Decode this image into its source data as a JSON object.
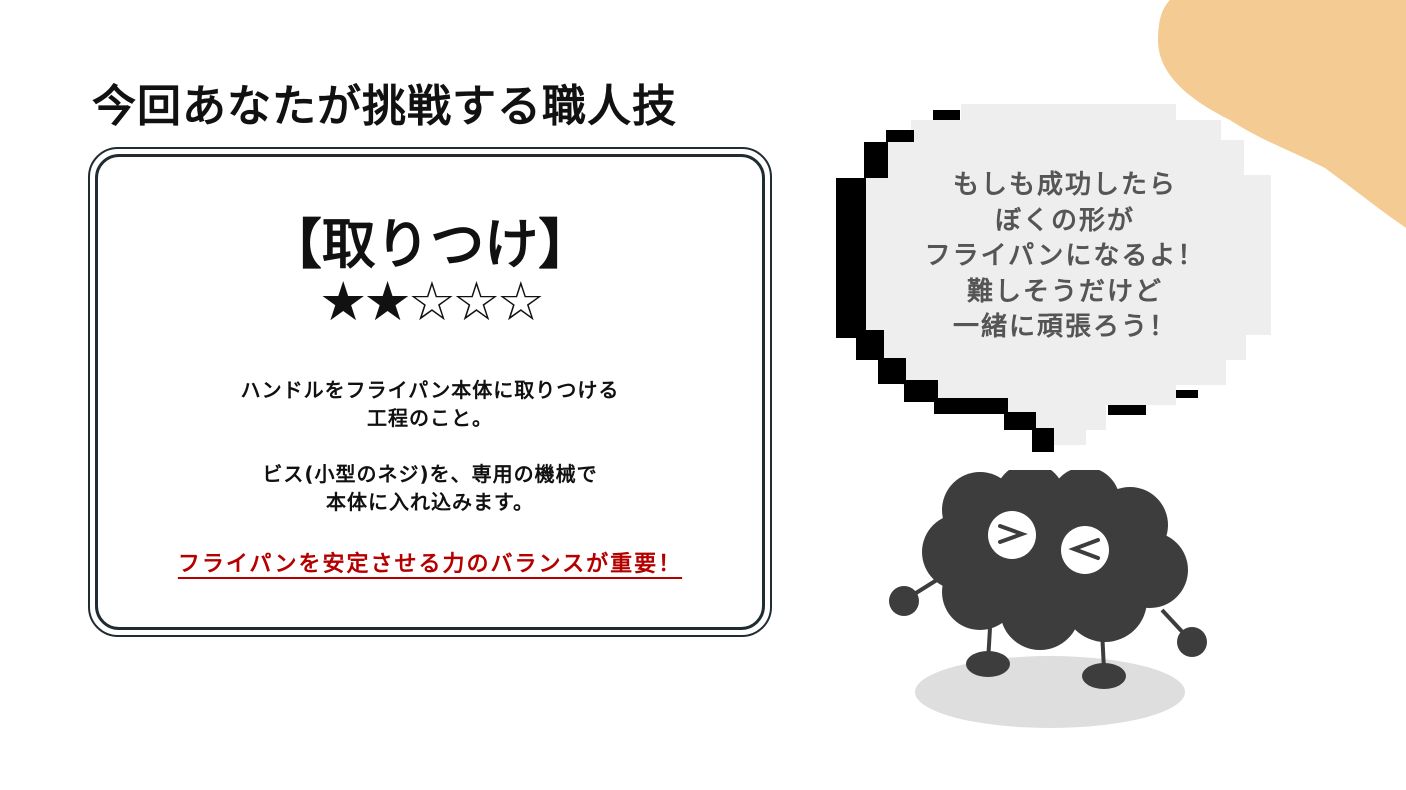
{
  "slide": {
    "title": "今回あなたが挑戦する職人技",
    "accent_color": "#f3cb93"
  },
  "skill_card": {
    "name": "【取りつけ】",
    "rating": 2,
    "rating_max": 5,
    "stars_filled": "★★",
    "stars_empty": "☆☆☆",
    "description_1": [
      "ハンドルをフライパン本体に取りつける",
      "工程のこと。"
    ],
    "description_2": [
      "ビス(小型のネジ)を、専用の機械で",
      "本体に入れ込みます。"
    ],
    "emphasis": "フライパンを安定させる力のバランスが重要！",
    "emphasis_color": "#b50000"
  },
  "speech_bubble": {
    "lines": [
      "もしも成功したら",
      "ぼくの形が",
      "フライパンになるよ！",
      "難しそうだけど",
      "一緒に頑張ろう！"
    ]
  },
  "mascot": {
    "icon": "cloud-character-icon",
    "body_color": "#3d3d3d"
  }
}
